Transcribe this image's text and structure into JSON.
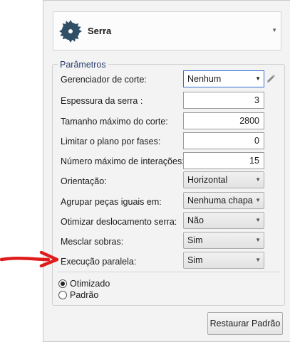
{
  "tool": {
    "name": "Serra",
    "icon": "circular-saw-icon"
  },
  "params": {
    "legend": "Parâmetros",
    "cutter_manager": {
      "label": "Gerenciador de corte:",
      "value": "Nenhum"
    },
    "saw_thickness": {
      "label": "Espessura da serra :",
      "value": "3"
    },
    "max_cut_size": {
      "label": "Tamanho máximo do corte:",
      "value": "2800"
    },
    "limit_plane_phases": {
      "label": "Limitar o plano por fases:",
      "value": "0"
    },
    "max_iterations": {
      "label": "Número máximo de interações:",
      "value": "15"
    },
    "orientation": {
      "label": "Orientação:",
      "value": "Horizontal"
    },
    "group_equal_parts": {
      "label": "Agrupar peças iguais em:",
      "value": "Nenhuma chapa"
    },
    "optimize_saw_travel": {
      "label": "Otimizar deslocamento serra:",
      "value": "Não"
    },
    "merge_leftovers": {
      "label": "Mesclar sobras:",
      "value": "Sim"
    },
    "parallel_execution": {
      "label": "Execução paralela:",
      "value": "Sim"
    }
  },
  "modes": [
    {
      "label": "Otimizado",
      "checked": true
    },
    {
      "label": "Padrão",
      "checked": false
    }
  ],
  "restore_button": "Restaurar Padrão",
  "icons": {
    "edit": "pencil-icon",
    "annotation": "red-arrow-icon"
  },
  "colors": {
    "annotation_arrow": "#e01b1b",
    "focus_border": "#2e6fd1"
  }
}
